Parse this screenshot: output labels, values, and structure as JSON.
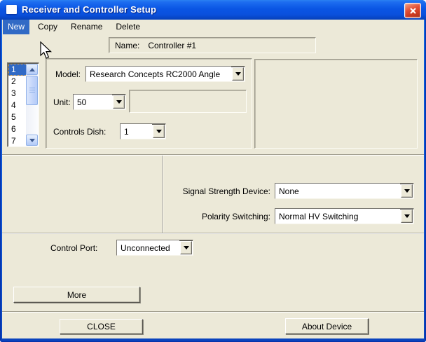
{
  "window": {
    "title": "Receiver and Controller Setup"
  },
  "menu": {
    "items": [
      {
        "label": "New",
        "highlighted": true
      },
      {
        "label": "Copy",
        "highlighted": false
      },
      {
        "label": "Rename",
        "highlighted": false
      },
      {
        "label": "Delete",
        "highlighted": false
      }
    ]
  },
  "name_field": {
    "label": "Name:",
    "value": "Controller #1"
  },
  "controller_list": {
    "items": [
      "1",
      "2",
      "3",
      "4",
      "5",
      "6",
      "7"
    ],
    "selected_item": "1"
  },
  "device_panel": {
    "model_label": "Model:",
    "model_value": "Research Concepts RC2000 Angle",
    "unit_label": "Unit:",
    "unit_value": "50",
    "controls_dish_label": "Controls Dish:",
    "controls_dish_value": "1"
  },
  "signal_panel": {
    "signal_strength_label": "Signal Strength Device:",
    "signal_strength_value": "None",
    "polarity_label": "Polarity Switching:",
    "polarity_value": "Normal HV Switching"
  },
  "port_panel": {
    "control_port_label": "Control Port:",
    "control_port_value": "Unconnected",
    "more_button_label": "More"
  },
  "footer": {
    "close_button_label": "CLOSE",
    "about_button_label": "About Device"
  },
  "icons": {
    "close_icon": "x",
    "window_icon": "white-window",
    "dropdown_arrow_icon": "down-triangle",
    "scroll_up_icon": "up-arrow",
    "scroll_down_icon": "down-arrow",
    "cursor_icon": "arrow-pointer"
  },
  "colors": {
    "body_background": "#ECE9D8",
    "titlebar_blue": "#0A55E4",
    "selection_blue": "#316AC5",
    "close_button_red": "#D84A2E",
    "scrollbar_blue": "#C3D5FA"
  }
}
